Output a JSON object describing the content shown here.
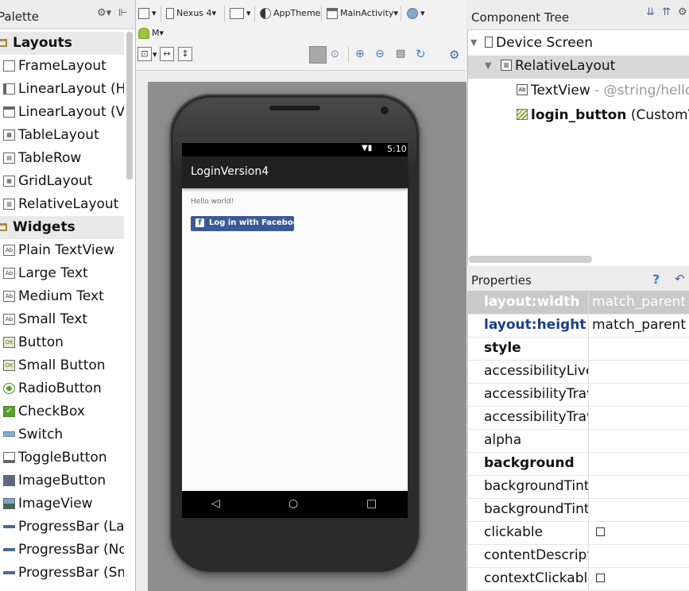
{
  "palette": {
    "title": "Palette",
    "groups": [
      {
        "label": "Layouts",
        "items": [
          "FrameLayout",
          "LinearLayout (Ho",
          "LinearLayout (Ver",
          "TableLayout",
          "TableRow",
          "GridLayout",
          "RelativeLayout"
        ]
      },
      {
        "label": "Widgets",
        "items": [
          "Plain TextView",
          "Large Text",
          "Medium Text",
          "Small Text",
          "Button",
          "Small Button",
          "RadioButton",
          "CheckBox",
          "Switch",
          "ToggleButton",
          "ImageButton",
          "ImageView",
          "ProgressBar (Larg",
          "ProgressBar (Nor",
          "ProgressBar (Sma"
        ]
      }
    ],
    "icons": {
      "settings": "gear-icon",
      "collapse": "collapse-icon"
    }
  },
  "toolbar": {
    "device": "Nexus 4",
    "theme": "AppTheme",
    "activity": "MainActivity",
    "api": "M"
  },
  "preview": {
    "status_time": "5:10",
    "app_title": "LoginVersion4",
    "hello_text": "Hello world!",
    "fb_button_label": "Log in with Facebook",
    "fb_glyph": "f",
    "nav": {
      "back": "◁",
      "home": "○",
      "recent": "□"
    }
  },
  "component_tree": {
    "title": "Component Tree",
    "nodes": [
      {
        "label": "Device Screen"
      },
      {
        "label": "RelativeLayout"
      },
      {
        "label": "TextView",
        "detail": " - @string/hello_"
      },
      {
        "label": "login_button",
        "detail": " (CustomVie"
      }
    ]
  },
  "properties": {
    "title": "Properties",
    "help": "?",
    "rows": [
      {
        "name": "layout:width",
        "value": "match_parent"
      },
      {
        "name": "layout:height",
        "value": "match_parent"
      },
      {
        "name": "style",
        "value": ""
      },
      {
        "name": "accessibilityLiveR",
        "value": ""
      },
      {
        "name": "accessibilityTrave",
        "value": ""
      },
      {
        "name": "accessibilityTrave",
        "value": ""
      },
      {
        "name": "alpha",
        "value": ""
      },
      {
        "name": "background",
        "value": ""
      },
      {
        "name": "backgroundTint",
        "value": ""
      },
      {
        "name": "backgroundTintM",
        "value": ""
      },
      {
        "name": "clickable",
        "value": ""
      },
      {
        "name": "contentDescripti",
        "value": ""
      },
      {
        "name": "contextClickable",
        "value": ""
      }
    ]
  },
  "colors": {
    "facebook": "#3b5998",
    "appbar": "#212121",
    "selection": "#c9c9c9",
    "link_blue": "#1a3e8c"
  }
}
